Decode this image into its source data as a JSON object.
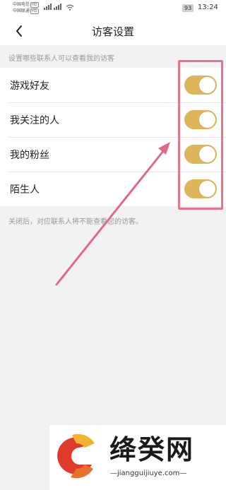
{
  "status_bar": {
    "carrier1": "中国电信",
    "carrier2": "中国联通",
    "hd_badge": "HD",
    "battery": "93",
    "time": "13:24"
  },
  "header": {
    "title": "访客设置",
    "back_icon": "chevron-left-icon"
  },
  "settings": {
    "section_hint": "设置哪些联系人可以查看我的访客",
    "items": [
      {
        "label": "游戏好友",
        "enabled": true
      },
      {
        "label": "我关注的人",
        "enabled": true
      },
      {
        "label": "我的粉丝",
        "enabled": true
      },
      {
        "label": "陌生人",
        "enabled": true
      }
    ],
    "footer_hint": "关闭后，对应联系人将不能查看您的访客。"
  },
  "annotation": {
    "highlight_color": "#e8738c",
    "arrow_color": "#e06a84"
  },
  "watermark": {
    "name": "绛癸网",
    "url": "—jiangguijiuye.com—"
  },
  "colors": {
    "toggle_on": "#ddb55a",
    "background": "#f2f2f2"
  }
}
